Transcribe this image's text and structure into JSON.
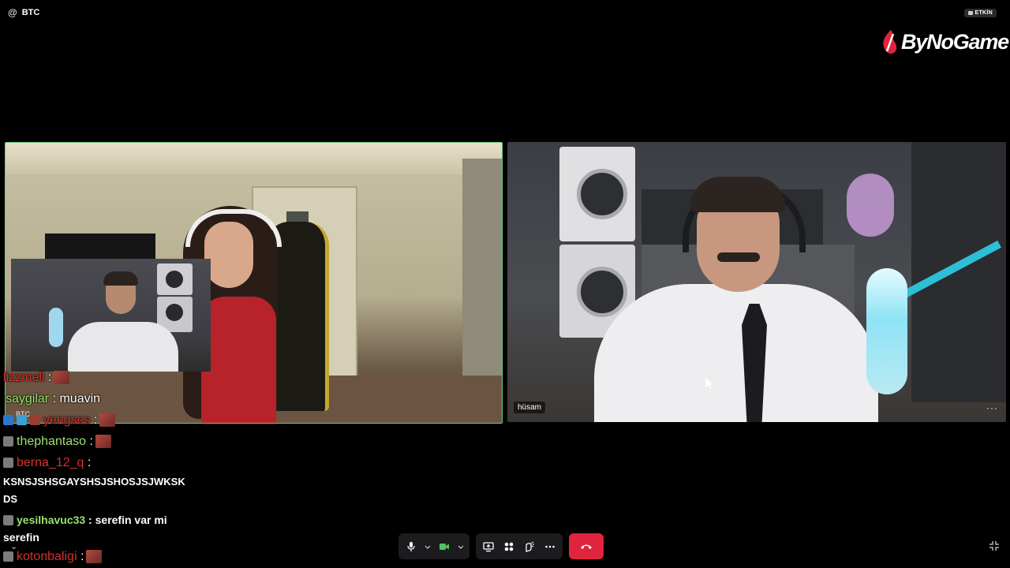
{
  "topbar": {
    "channel": "BTC",
    "status_label": "ETKİN"
  },
  "brand": {
    "name": "ByNoGame"
  },
  "tiles": {
    "left": {
      "pip_label": "BTC"
    },
    "right": {
      "name": "hüsam",
      "menu": "···"
    }
  },
  "chat": [
    {
      "user": "lizzmeli",
      "sep": " :",
      "text": "",
      "emote": true,
      "user_color": "red"
    },
    {
      "user": "saygilar",
      "sep": " :",
      "text": " muavin",
      "emote": false,
      "user_color": "green"
    },
    {
      "user": "yengses",
      "sep": " :",
      "text": "",
      "emote": true,
      "user_color": "red"
    },
    {
      "user": "thephantaso",
      "sep": " :",
      "text": "",
      "emote": true,
      "user_color": "green"
    },
    {
      "user": "berna_12_q",
      "sep": " :",
      "text": "KSNSJSHSGAYSHSJSHOSJSJWKSK DS",
      "emote": false,
      "user_color": "red"
    },
    {
      "user": "yesilhavuc33",
      "sep": " :",
      "text": " serefin var mi serefin",
      "emote": false,
      "user_color": "green"
    },
    {
      "user": "kotonbaligi",
      "sep": " :",
      "text": "",
      "emote": true,
      "user_color": "red"
    }
  ],
  "icons": {
    "at": "@",
    "chevron": "⌄"
  },
  "colors": {
    "active_speaker_border": "#6fcf87",
    "leave_button": "#e0243e",
    "camera_on": "#4fc36b"
  }
}
